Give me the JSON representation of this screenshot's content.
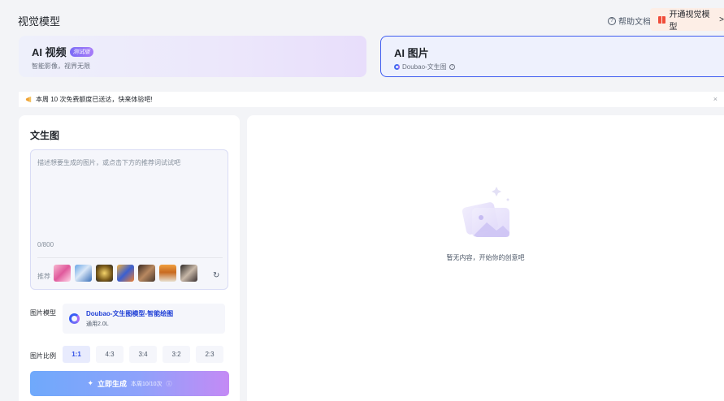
{
  "header": {
    "title": "视觉模型",
    "help_label": "帮助文档",
    "upgrade_label": "开通视觉模型",
    "upgrade_chevron": ">"
  },
  "modes": [
    {
      "title": "AI 视频",
      "badge": "测试版",
      "subtitle": "智能影像，视界无限",
      "selected": false
    },
    {
      "title": "AI 图片",
      "subtitle": "Doubao-文生图",
      "selected": true
    }
  ],
  "notice": {
    "text": "本周 10 次免费额度已送达，快来体验吧!",
    "close": "×"
  },
  "form": {
    "section_title": "文生图",
    "prompt_placeholder": "描述想要生成的图片，或点击下方的推荐词试试吧",
    "counter": "0/800",
    "recommend_label": "推荐",
    "model_label": "图片模型",
    "model_name": "Doubao-文生图模型-智能绘图",
    "model_version": "通用2.0L",
    "ratio_label": "图片比例",
    "ratios": [
      "1:1",
      "4:3",
      "3:4",
      "3:2",
      "2:3"
    ],
    "selected_ratio": "1:1",
    "generate_label": "立即生成",
    "generate_quota": "本周10/10次"
  },
  "result": {
    "empty_text": "暂无内容，开始你的创意吧"
  },
  "colors": {
    "accent": "#3f5cf0",
    "gift": "#f04d3a"
  }
}
